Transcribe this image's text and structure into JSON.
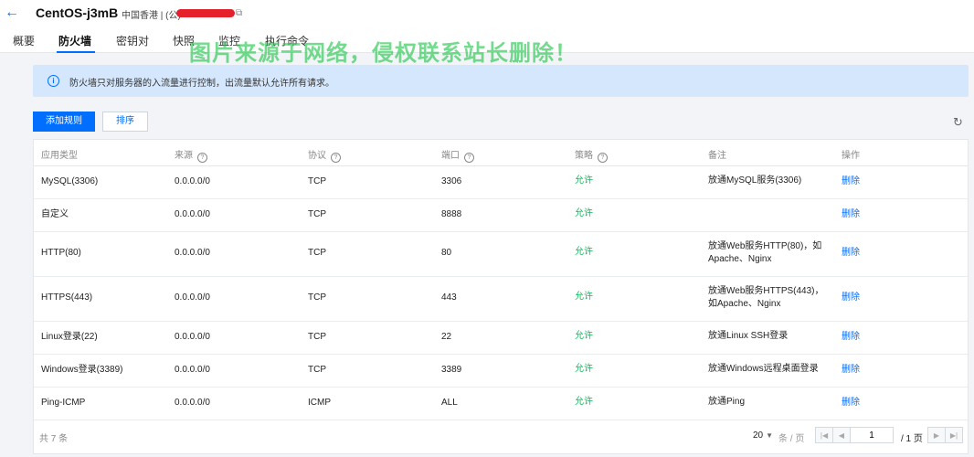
{
  "header": {
    "title": "CentOS-j3mB",
    "region": "中国香港 | (公)"
  },
  "tabs": [
    {
      "label": "概要"
    },
    {
      "label": "防火墙"
    },
    {
      "label": "密钥对"
    },
    {
      "label": "快照"
    },
    {
      "label": "监控"
    },
    {
      "label": "执行命令"
    }
  ],
  "watermark": "图片来源于网络，侵权联系站长删除！",
  "notice": {
    "text": "防火墙只对服务器的入流量进行控制，出流量默认允许所有请求。"
  },
  "toolbar": {
    "add_label": "添加规则",
    "sort_label": "排序"
  },
  "table": {
    "columns": [
      "应用类型",
      "来源",
      "协议",
      "端口",
      "策略",
      "备注",
      "操作"
    ],
    "rows": [
      {
        "app": "MySQL(3306)",
        "source": "0.0.0.0/0",
        "protocol": "TCP",
        "port": "3306",
        "policy": "允许",
        "note": "放通MySQL服务(3306)",
        "action": "删除"
      },
      {
        "app": "自定义",
        "source": "0.0.0.0/0",
        "protocol": "TCP",
        "port": "8888",
        "policy": "允许",
        "note": "",
        "action": "删除"
      },
      {
        "app": "HTTP(80)",
        "source": "0.0.0.0/0",
        "protocol": "TCP",
        "port": "80",
        "policy": "允许",
        "note": "放通Web服务HTTP(80)，如Apache、Nginx",
        "action": "删除"
      },
      {
        "app": "HTTPS(443)",
        "source": "0.0.0.0/0",
        "protocol": "TCP",
        "port": "443",
        "policy": "允许",
        "note": "放通Web服务HTTPS(443)，如Apache、Nginx",
        "action": "删除"
      },
      {
        "app": "Linux登录(22)",
        "source": "0.0.0.0/0",
        "protocol": "TCP",
        "port": "22",
        "policy": "允许",
        "note": "放通Linux SSH登录",
        "action": "删除"
      },
      {
        "app": "Windows登录(3389)",
        "source": "0.0.0.0/0",
        "protocol": "TCP",
        "port": "3389",
        "policy": "允许",
        "note": "放通Windows远程桌面登录",
        "action": "删除"
      },
      {
        "app": "Ping-ICMP",
        "source": "0.0.0.0/0",
        "protocol": "ICMP",
        "port": "ALL",
        "policy": "允许",
        "note": "放通Ping",
        "action": "删除"
      }
    ]
  },
  "pagination": {
    "total": "共 7 条",
    "per_page": "20",
    "per_unit": "条 / 页",
    "page": "1",
    "pages": "/ 1 页"
  },
  "colors": {
    "accent": "#006eff",
    "allow": "#0abf5b",
    "notice_bg": "#d5e7fd"
  }
}
